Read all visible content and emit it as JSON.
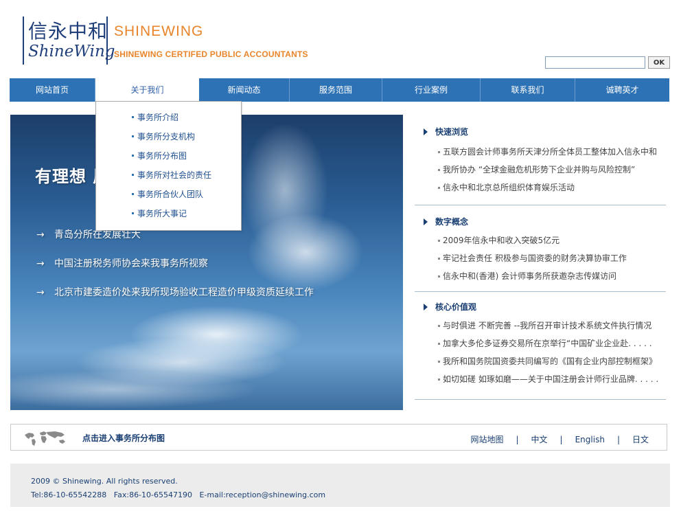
{
  "header": {
    "logo_cn": "信永中和",
    "logo_en": "ShineWing",
    "brand_name": "SHINEWING",
    "brand_sub": "SHINEWING CERTIFED PUBLIC ACCOUNTANTS"
  },
  "search": {
    "value": "",
    "placeholder": "",
    "button_label": "OK"
  },
  "nav": {
    "items": [
      {
        "label": "网站首页"
      },
      {
        "label": "关于我们"
      },
      {
        "label": "新闻动态"
      },
      {
        "label": "服务范围"
      },
      {
        "label": "行业案例"
      },
      {
        "label": "联系我们"
      },
      {
        "label": "诚聘英才"
      }
    ],
    "active_index": 1
  },
  "dropdown": {
    "items": [
      {
        "label": "事务所介绍"
      },
      {
        "label": "事务所分支机构"
      },
      {
        "label": "事务所分布图"
      },
      {
        "label": "事务所对社会的责任"
      },
      {
        "label": "事务所合伙人团队"
      },
      {
        "label": "事务所大事记"
      }
    ]
  },
  "banner": {
    "title": "有理想 展的品牌事务所",
    "lines": [
      {
        "arrow": "→",
        "text": "青岛分所在发展壮大"
      },
      {
        "arrow": "→",
        "text": "中国注册税务师协会来我事务所视察"
      },
      {
        "arrow": "→",
        "text": "北京市建委造价处来我所现场验收工程造价甲级资质延续工作"
      }
    ]
  },
  "sections": [
    {
      "title": "快速浏览",
      "items": [
        {
          "text": "五联方圆会计师事务所天津分所全体员工整体加入信永中和"
        },
        {
          "text": "我所协办 “全球金融危机形势下企业并购与风险控制”"
        },
        {
          "text": "信永中和北京总所组织体育娱乐活动"
        }
      ]
    },
    {
      "title": "数字概念",
      "items": [
        {
          "text": "2009年信永中和收入突破5亿元"
        },
        {
          "text": "牢记社会责任 积极参与国资委的财务决算协审工作"
        },
        {
          "text": "信永中和(香港) 会计师事务所获邀杂志传媒访问"
        }
      ]
    },
    {
      "title": "核心价值观",
      "items": [
        {
          "text": "与时俱进 不断完善 --我所召开审计技术系统文件执行情况"
        },
        {
          "text": "加拿大多伦多证券交易所在京举行“中国矿业企业赴. . . . ."
        },
        {
          "text": "我所和国务院国资委共同编写的《国有企业内部控制框架》"
        },
        {
          "text": "如切如磋 如琢如磨——关于中国注册会计师行业品牌. . . . ."
        }
      ]
    }
  ],
  "mapbar": {
    "link": "点击进入事务所分布图",
    "langs": [
      {
        "label": "网站地图"
      },
      {
        "label": "中文"
      },
      {
        "label": "English"
      },
      {
        "label": "日文"
      }
    ],
    "separator": "|"
  },
  "footer": {
    "copyright": "2009 © Shinewing. All rights reserved.",
    "contact": "Tel:86-10-65542288   Fax:86-10-65547190   E-mail:reception@shinewing.com"
  },
  "colors": {
    "nav": "#2e72b6",
    "brand_orange": "#e8852a",
    "dark_blue": "#1a3f73"
  }
}
